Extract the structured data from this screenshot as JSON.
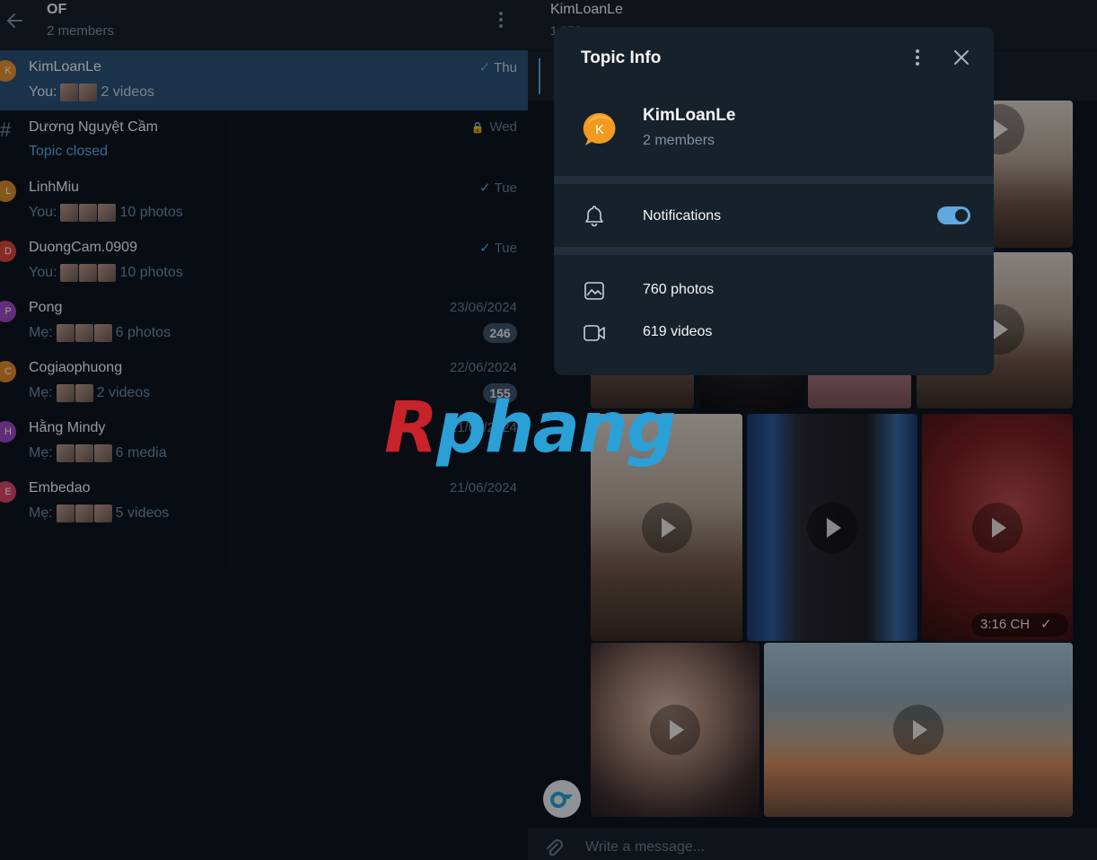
{
  "left_header": {
    "title": "OF",
    "subtitle": "2 members"
  },
  "chats": [
    {
      "avatar": "K",
      "avatar_color": "#e5912f",
      "name": "KimLoanLe",
      "date": "Thu",
      "status": "read",
      "sender": "You:",
      "thumbs": 2,
      "preview": "2 videos",
      "active": true
    },
    {
      "avatar": "#",
      "name": "Dương Nguyệt Cầm",
      "date": "Wed",
      "status": "locked",
      "preview": "Topic closed"
    },
    {
      "avatar": "L",
      "avatar_color": "#d98b2b",
      "name": "LinhMiu",
      "date": "Tue",
      "status": "read",
      "sender": "You:",
      "thumbs": 3,
      "preview": "10 photos"
    },
    {
      "avatar": "D",
      "avatar_color": "#d9463c",
      "name": "DuongCam.0909",
      "date": "Tue",
      "status": "read",
      "sender": "You:",
      "thumbs": 3,
      "preview": "10 photos"
    },
    {
      "avatar": "P",
      "avatar_color": "#9b4bc7",
      "name": "Pong",
      "date": "23/06/2024",
      "sender": "Mẹ:",
      "thumbs": 3,
      "preview": "6 photos",
      "badge": "246"
    },
    {
      "avatar": "C",
      "avatar_color": "#e08a2a",
      "name": "Cogiaophuong",
      "date": "22/06/2024",
      "sender": "Mẹ:",
      "thumbs": 2,
      "preview": "2 videos",
      "badge": "155"
    },
    {
      "avatar": "H",
      "avatar_color": "#9b4bc7",
      "name": "Hằng Mindy",
      "date": "21/06/2024",
      "sender": "Mẹ:",
      "thumbs": 3,
      "preview": "6 media"
    },
    {
      "avatar": "E",
      "avatar_color": "#d9466a",
      "name": "Embedao",
      "date": "21/06/2024",
      "sender": "Mẹ:",
      "thumbs": 3,
      "preview": "5 videos"
    }
  ],
  "right_header": {
    "title": "KimLoanLe",
    "subtitle": "1,372"
  },
  "message": {
    "time": "3:16 CH",
    "status": "read"
  },
  "composer": {
    "placeholder": "Write a message..."
  },
  "dialog": {
    "title": "Topic Info",
    "topic_letter": "K",
    "topic_color": "#f29a1f",
    "topic_name": "KimLoanLe",
    "members": "2 members",
    "notifications_label": "Notifications",
    "notifications_on": true,
    "photos": "760 photos",
    "videos": "619 videos"
  },
  "watermark": {
    "red": "R",
    "blue": "phang"
  }
}
